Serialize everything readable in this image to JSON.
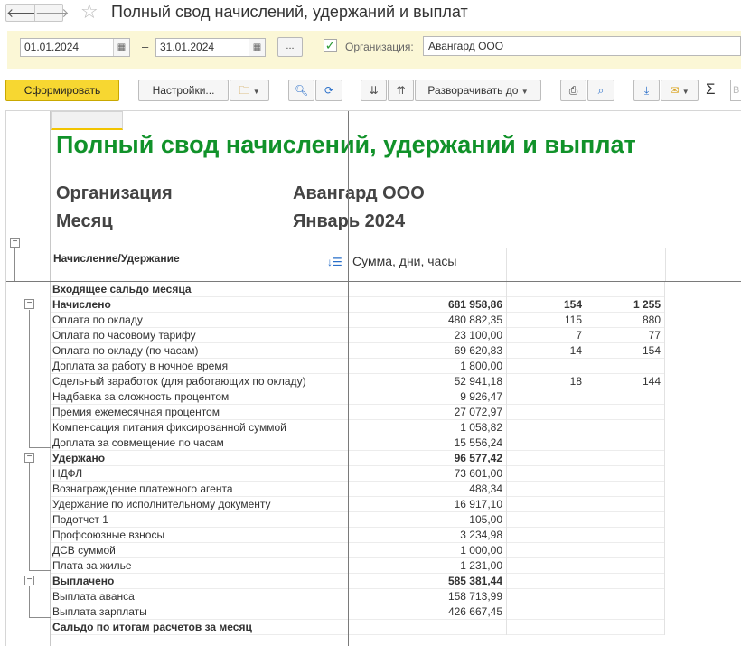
{
  "window": {
    "title": "Полный свод начислений, удержаний и выплат",
    "back_glyph": "🡐",
    "forward_glyph": "🡒"
  },
  "params": {
    "date_from": "01.01.2024",
    "date_to": "31.01.2024",
    "dash": "–",
    "more_label": "...",
    "org_checked": "✓",
    "org_label": "Организация:",
    "org_value": "Авангард ООО"
  },
  "toolbar": {
    "generate_label": "Сформировать",
    "settings_label": "Настройки...",
    "expand_label": "Разворачивать до",
    "sigma": "Σ"
  },
  "report": {
    "title": "Полный свод начислений, удержаний и выплат",
    "org_key": "Организация",
    "org_value": "Авангард ООО",
    "month_key": "Месяц",
    "month_value": "Январь 2024",
    "col_item": "Начисление/Удержание",
    "col_sum": "Сумма, дни, часы",
    "rows": [
      {
        "label": "Входящее сальдо месяца",
        "sum": "",
        "days": "",
        "hours": "",
        "bold": true
      },
      {
        "label": "Начислено",
        "sum": "681 958,86",
        "days": "154",
        "hours": "1 255",
        "bold": true
      },
      {
        "label": "Оплата по окладу",
        "sum": "480 882,35",
        "days": "115",
        "hours": "880",
        "bold": false
      },
      {
        "label": "Оплата по часовому тарифу",
        "sum": "23 100,00",
        "days": "7",
        "hours": "77",
        "bold": false
      },
      {
        "label": "Оплата по окладу (по часам)",
        "sum": "69 620,83",
        "days": "14",
        "hours": "154",
        "bold": false
      },
      {
        "label": "Доплата за работу в ночное время",
        "sum": "1 800,00",
        "days": "",
        "hours": "",
        "bold": false
      },
      {
        "label": "Сдельный заработок (для работающих по окладу)",
        "sum": "52 941,18",
        "days": "18",
        "hours": "144",
        "bold": false
      },
      {
        "label": "Надбавка за сложность процентом",
        "sum": "9 926,47",
        "days": "",
        "hours": "",
        "bold": false
      },
      {
        "label": "Премия ежемесячная процентом",
        "sum": "27 072,97",
        "days": "",
        "hours": "",
        "bold": false
      },
      {
        "label": "Компенсация питания фиксированной суммой",
        "sum": "1 058,82",
        "days": "",
        "hours": "",
        "bold": false
      },
      {
        "label": "Доплата за совмещение по часам",
        "sum": "15 556,24",
        "days": "",
        "hours": "",
        "bold": false
      },
      {
        "label": "Удержано",
        "sum": "96 577,42",
        "days": "",
        "hours": "",
        "bold": true
      },
      {
        "label": "НДФЛ",
        "sum": "73 601,00",
        "days": "",
        "hours": "",
        "bold": false
      },
      {
        "label": "Вознаграждение платежного агента",
        "sum": "488,34",
        "days": "",
        "hours": "",
        "bold": false
      },
      {
        "label": "Удержание по исполнительному документу",
        "sum": "16 917,10",
        "days": "",
        "hours": "",
        "bold": false
      },
      {
        "label": "Подотчет 1",
        "sum": "105,00",
        "days": "",
        "hours": "",
        "bold": false
      },
      {
        "label": "Профсоюзные взносы",
        "sum": "3 234,98",
        "days": "",
        "hours": "",
        "bold": false
      },
      {
        "label": "ДСВ суммой",
        "sum": "1 000,00",
        "days": "",
        "hours": "",
        "bold": false
      },
      {
        "label": "Плата за жилье",
        "sum": "1 231,00",
        "days": "",
        "hours": "",
        "bold": false
      },
      {
        "label": "Выплачено",
        "sum": "585 381,44",
        "days": "",
        "hours": "",
        "bold": true
      },
      {
        "label": "Выплата аванса",
        "sum": "158 713,99",
        "days": "",
        "hours": "",
        "bold": false
      },
      {
        "label": "Выплата зарплаты",
        "sum": "426 667,45",
        "days": "",
        "hours": "",
        "bold": false
      },
      {
        "label": "Сальдо по итогам расчетов за месяц",
        "sum": "",
        "days": "",
        "hours": "",
        "bold": true
      }
    ]
  },
  "colors": {
    "title_green": "#11922a",
    "primary_button": "#f7d731",
    "params_bg": "#fbf7d6"
  }
}
